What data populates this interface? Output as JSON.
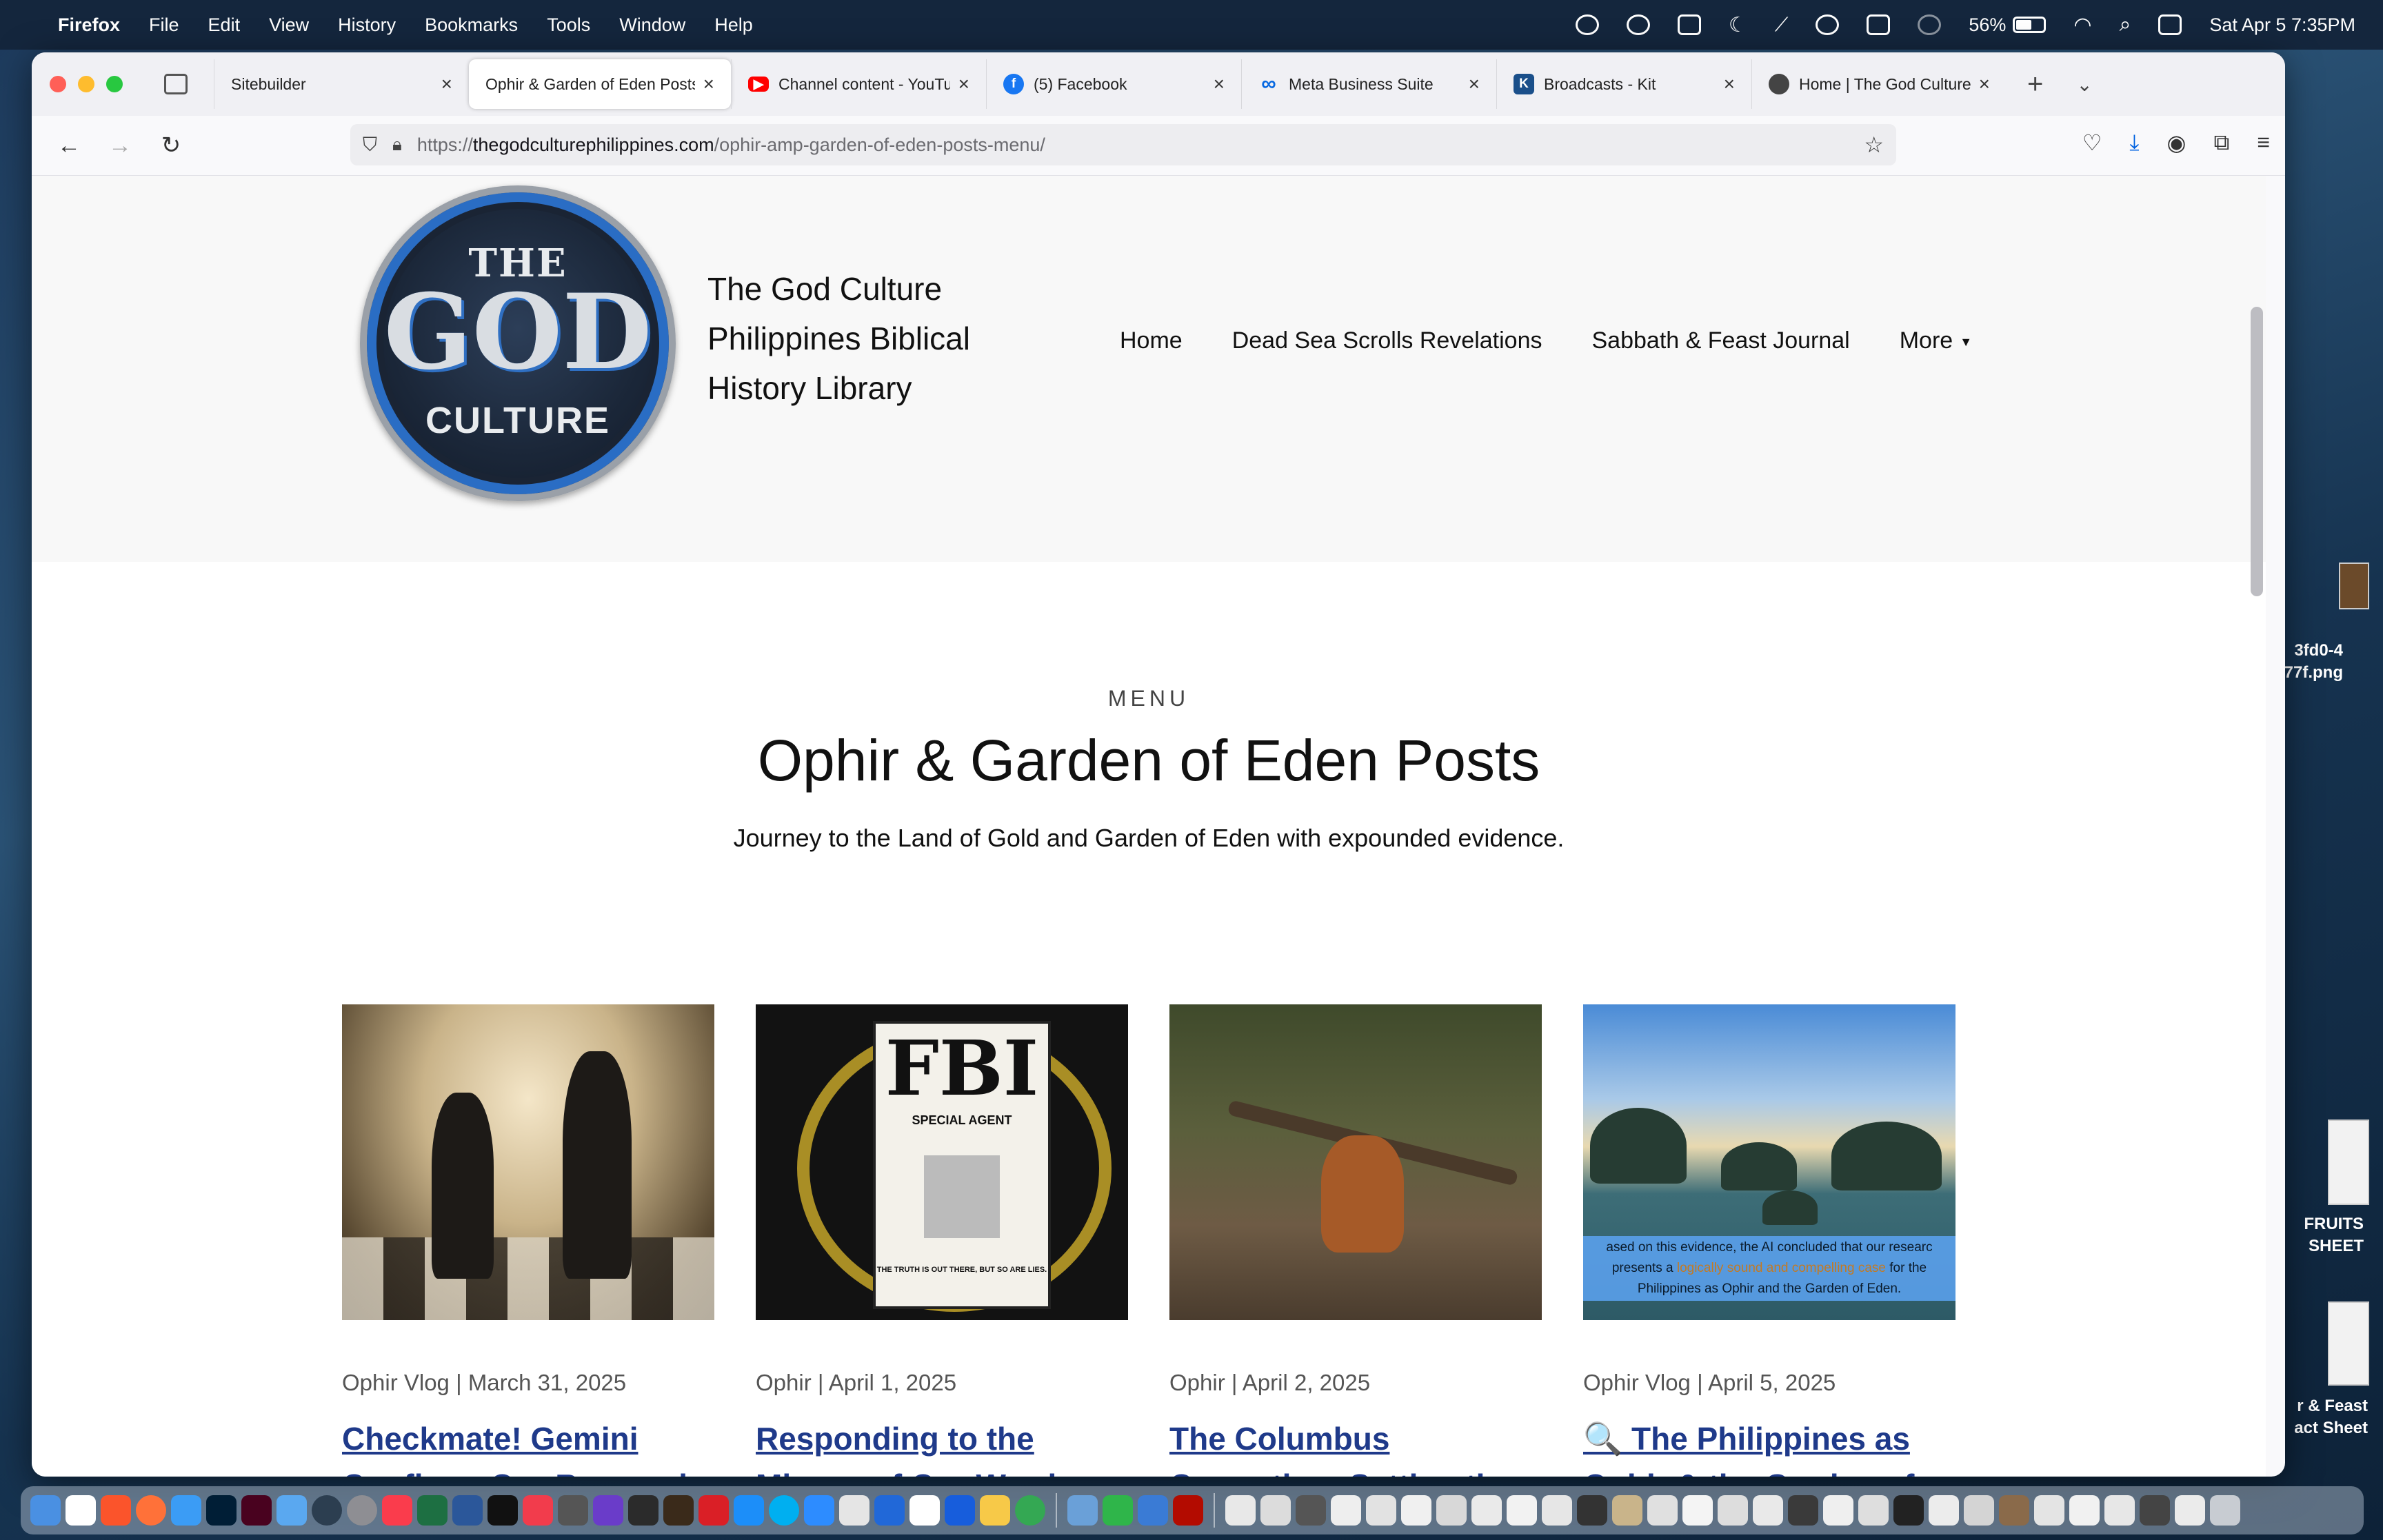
{
  "menubar": {
    "app": "Firefox",
    "items": [
      "File",
      "Edit",
      "View",
      "History",
      "Bookmarks",
      "Tools",
      "Window",
      "Help"
    ],
    "battery": "56%",
    "battery_level": 0.56,
    "datetime": "Sat Apr 5  7:35PM"
  },
  "desktop": {
    "file1": "3fd0-4\n77f.png",
    "file2": "FRUITS\nSHEET",
    "file3": "r & Feast\nact Sheet"
  },
  "tabs": [
    {
      "label": "Sitebuilder",
      "icon": "blank-page-icon",
      "active": false
    },
    {
      "label": "Ophir & Garden of Eden Posts",
      "icon": "none",
      "active": true
    },
    {
      "label": "Channel content - YouTube",
      "icon": "youtube-icon",
      "active": false,
      "color": "#ff0000"
    },
    {
      "label": "(5) Facebook",
      "icon": "facebook-icon",
      "active": false,
      "color": "#1877f2"
    },
    {
      "label": "Meta Business Suite",
      "icon": "meta-icon",
      "active": false,
      "color": "#0668e1"
    },
    {
      "label": "Broadcasts - Kit",
      "icon": "kit-icon",
      "active": false,
      "color": "#1a73c9"
    },
    {
      "label": "Home | The God Culture",
      "icon": "globe-icon",
      "active": false
    }
  ],
  "urlbar": {
    "scheme": "https://",
    "domain": "thegodculturephilippines.com",
    "path": "/ophir-amp-garden-of-eden-posts-menu/"
  },
  "site": {
    "logo_the": "THE",
    "logo_god": "GOD",
    "logo_culture": "CULTURE",
    "title": "The God Culture Philippines Biblical History Library",
    "nav": [
      "Home",
      "Dead Sea Scrolls Revelations",
      "Sabbath & Feast Journal",
      "More"
    ]
  },
  "main": {
    "label": "MENU",
    "title": "Ophir & Garden of Eden Posts",
    "description": "Journey to the Land of Gold and Garden of Eden with expounded evidence."
  },
  "posts": [
    {
      "meta": "Ophir Vlog | March 31, 2025",
      "title": "Checkmate! Gemini Confirms Our Research"
    },
    {
      "meta": "Ophir | April 1, 2025",
      "title": "Responding to the Misuse of Our Words"
    },
    {
      "meta": "Ophir | April 2, 2025",
      "title": "The Columbus Correction: Setting the"
    },
    {
      "meta": "Ophir Vlog | April 5, 2025",
      "title": "🔍 The Philippines as Ophir & the Garden of"
    }
  ],
  "fbi_image": {
    "heading": "FBI",
    "subheading": "SPECIAL AGENT",
    "tagline": "THE TRUTH IS OUT THERE, BUT SO ARE LIES."
  },
  "bay_image": {
    "caption_1": "ased on this evidence, the AI concluded that our researc",
    "caption_2a": " presents a ",
    "caption_2b": "logically sound and compelling case",
    "caption_2c": " for the",
    "caption_3": "Philippines as Ophir and the Garden of Eden."
  }
}
